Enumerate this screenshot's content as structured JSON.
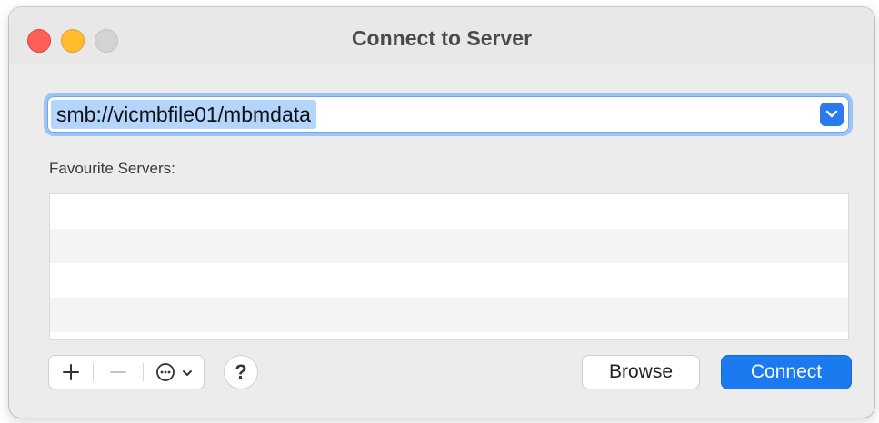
{
  "window": {
    "title": "Connect to Server",
    "traffic_lights": {
      "close": "#fe5f57",
      "minimize": "#febc2e",
      "zoom": "#d3d3d3"
    }
  },
  "address": {
    "value": "smb://vicmbfile01/mbmdata",
    "dropdown_icon": "chevron-down-icon",
    "accent_color": "#2b79ec"
  },
  "favourites": {
    "label": "Favourite Servers:",
    "items": []
  },
  "toolbar": {
    "add_icon": "plus-icon",
    "remove_icon": "minus-icon",
    "more_icon": "ellipsis-circle-icon",
    "help_label": "?"
  },
  "buttons": {
    "browse_label": "Browse",
    "connect_label": "Connect",
    "connect_color": "#1b7af0"
  }
}
